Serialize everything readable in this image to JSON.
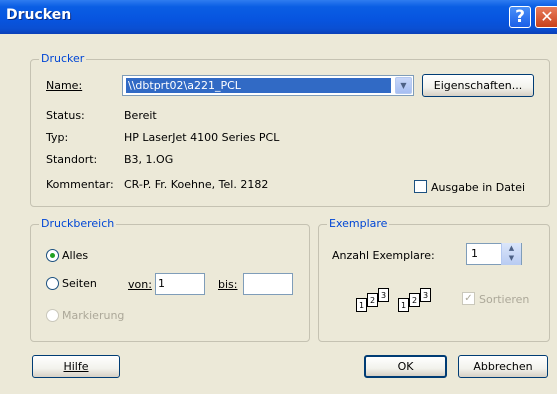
{
  "window": {
    "title": "Drucken"
  },
  "printer": {
    "group_label": "Drucker",
    "name_label": "Name:",
    "name_value": "\\\\dbtprt02\\a221_PCL",
    "properties_button": "Eigenschaften...",
    "status_label": "Status:",
    "status_value": "Bereit",
    "type_label": "Typ:",
    "type_value": "HP LaserJet 4100 Series PCL",
    "location_label": "Standort:",
    "location_value": "B3, 1.OG",
    "comment_label": "Kommentar:",
    "comment_value": "CR-P. Fr. Koehne, Tel. 2182",
    "print_to_file_label": "Ausgabe in Datei",
    "print_to_file_checked": false
  },
  "range": {
    "group_label": "Druckbereich",
    "all_label": "Alles",
    "pages_label": "Seiten",
    "from_label": "von:",
    "from_value": "1",
    "to_label": "bis:",
    "to_value": "",
    "selection_label": "Markierung",
    "selected": "all"
  },
  "copies": {
    "group_label": "Exemplare",
    "count_label": "Anzahl Exemplare:",
    "count_value": "1",
    "collate_label": "Sortieren",
    "collate_checked": true,
    "collate_disabled": true,
    "page_numbers": [
      "1",
      "2",
      "3"
    ]
  },
  "buttons": {
    "help": "Hilfe",
    "ok": "OK",
    "cancel": "Abbrechen"
  }
}
